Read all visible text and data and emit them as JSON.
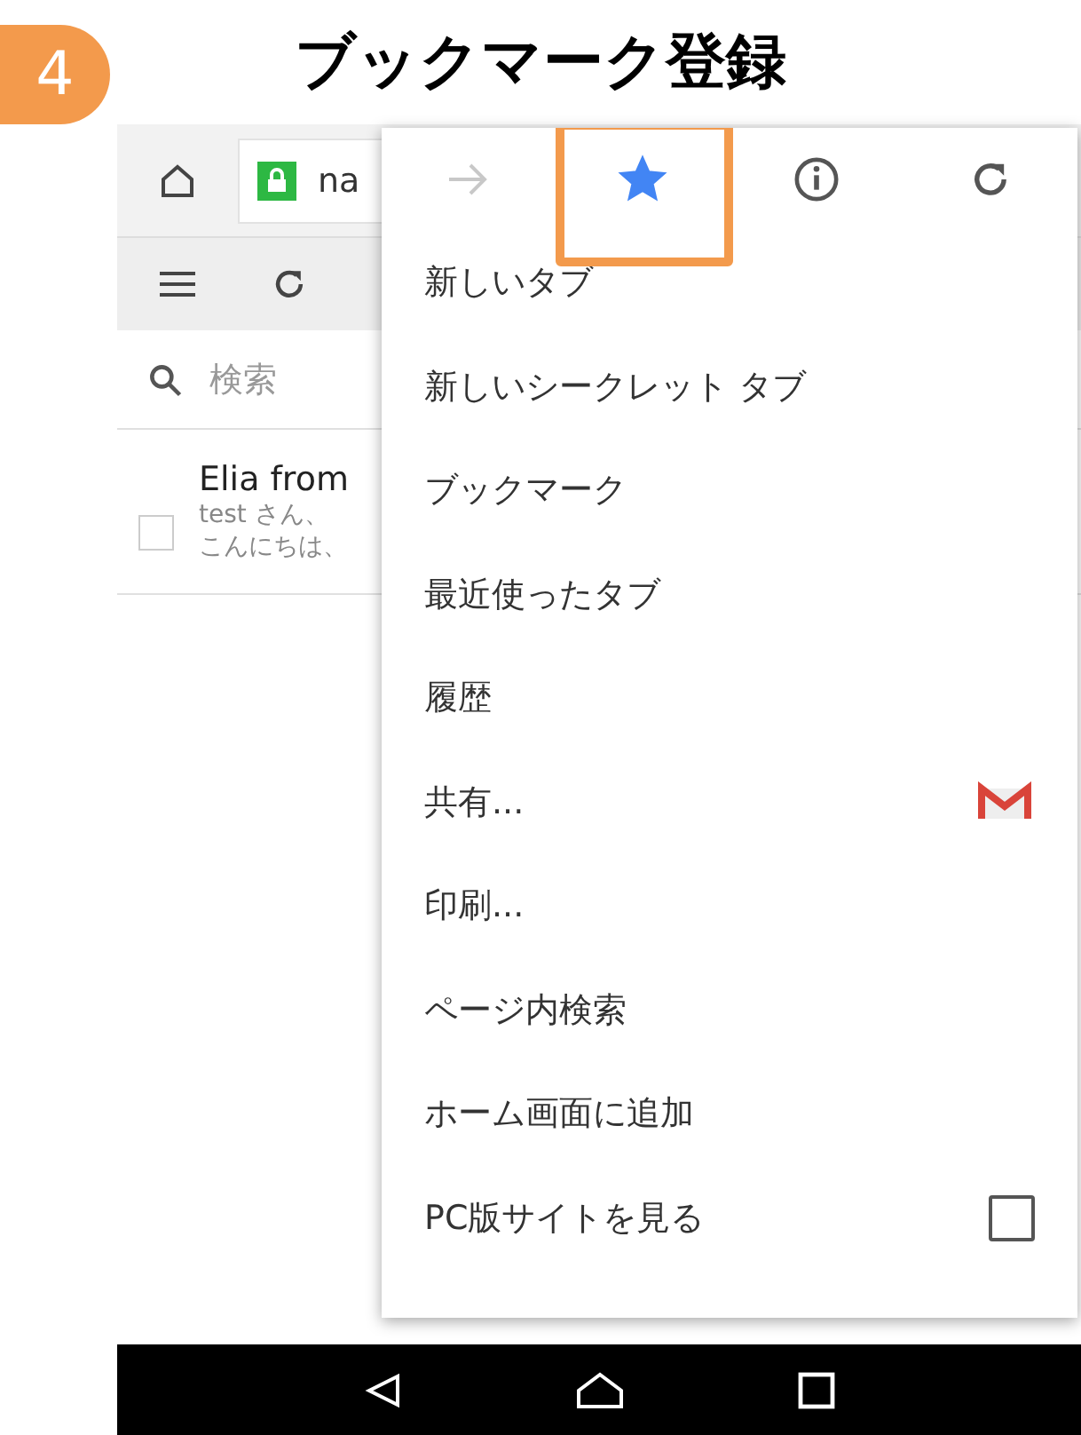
{
  "step": {
    "number": "4",
    "title": "ブックマーク登録"
  },
  "browser": {
    "url": "na",
    "search": {
      "placeholder": "検索"
    },
    "mail": {
      "sender": "Elia from",
      "line_1": "test さん、",
      "line_2": "こんにちは、",
      "checked": false
    }
  },
  "menu": {
    "icons": [
      {
        "kind": "forward",
        "disabled": true,
        "highlighted": false
      },
      {
        "kind": "bookmark",
        "disabled": false,
        "highlighted": true,
        "on": true
      },
      {
        "kind": "info",
        "disabled": false,
        "highlighted": false
      },
      {
        "kind": "reload",
        "disabled": false,
        "highlighted": false
      }
    ],
    "items": [
      {
        "kind": "plain",
        "label": "新しいタブ"
      },
      {
        "kind": "plain",
        "label": "新しいシークレット タブ"
      },
      {
        "kind": "plain",
        "label": "ブックマーク"
      },
      {
        "kind": "plain",
        "label": "最近使ったタブ"
      },
      {
        "kind": "plain",
        "label": "履歴"
      },
      {
        "kind": "share",
        "label": "共有..."
      },
      {
        "kind": "plain",
        "label": "印刷..."
      },
      {
        "kind": "plain",
        "label": "ページ内検索"
      },
      {
        "kind": "plain",
        "label": "ホーム画面に追加"
      },
      {
        "kind": "checkbox",
        "label": "PC版サイトを見る",
        "checked": false
      }
    ]
  }
}
